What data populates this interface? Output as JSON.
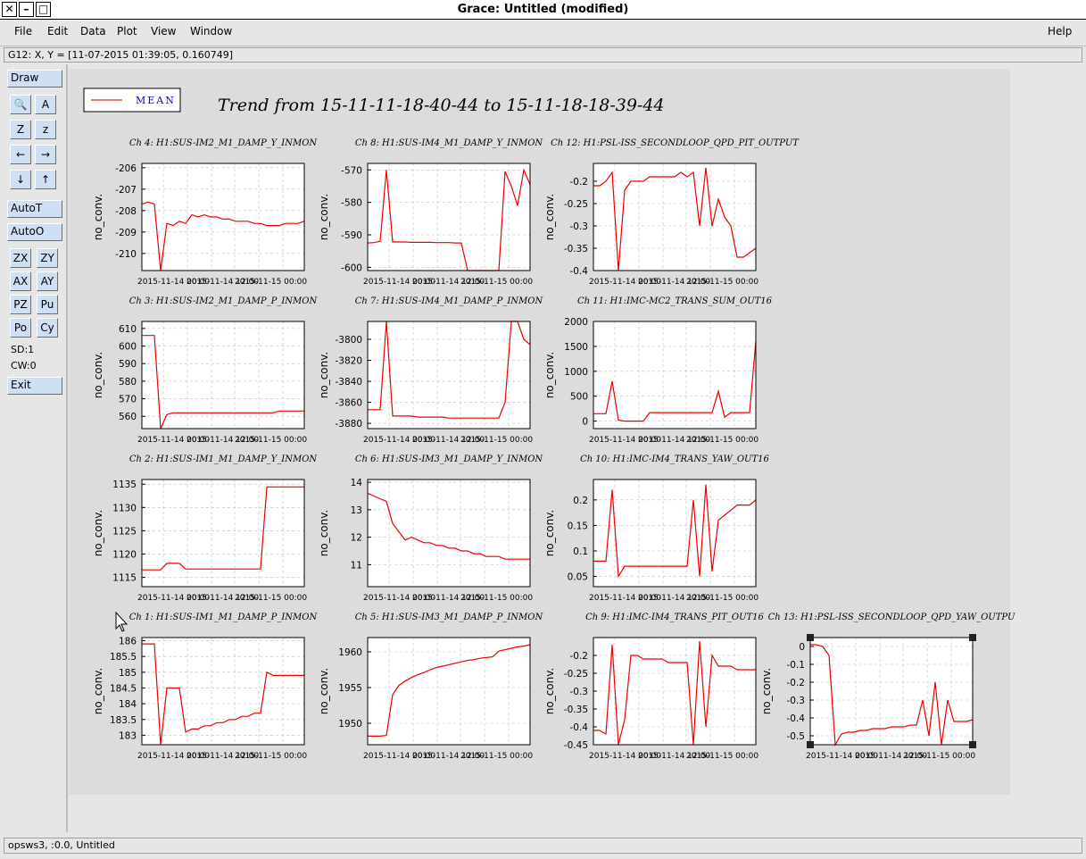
{
  "window": {
    "title": "Grace: Untitled (modified)",
    "close_glyph": "✕",
    "minimize_glyph": "–",
    "maximize_glyph": "□"
  },
  "menu": {
    "items": [
      "File",
      "Edit",
      "Data",
      "Plot",
      "View",
      "Window"
    ],
    "help": "Help"
  },
  "locator": {
    "text": "G12: X, Y = [11-07-2015 01:39:05, 0.160749]"
  },
  "toolbar": {
    "draw": "Draw",
    "zoom_glyph": "🔍",
    "text_glyph": "A",
    "z_glyph": "Z",
    "z_small_glyph": "z",
    "left_glyph": "←",
    "right_glyph": "→",
    "down_glyph": "↓",
    "up_glyph": "↑",
    "autot": "AutoT",
    "autoo": "AutoO",
    "zx": "ZX",
    "zy": "ZY",
    "ax": "AX",
    "ay": "AY",
    "pz": "PZ",
    "pu": "Pu",
    "po": "Po",
    "cy": "Cy",
    "sd": "SD:1",
    "cw": "CW:0",
    "exit": "Exit"
  },
  "status": {
    "text": "opsws3, :0.0, Untitled"
  },
  "legend": {
    "label": "MEAN",
    "color": "#cc0000"
  },
  "colors": {
    "trace": "#ee0000",
    "legend_text": "#0000cc",
    "canvas": "#dcdcdc"
  },
  "page_title": "Trend from 15-11-11-18-40-44 to 15-11-18-18-39-44",
  "x_tick_labels": [
    "2015-11-14 00:00",
    "2015-11-14 12:00",
    "2015-11-15 00:00"
  ],
  "chart_data": [
    {
      "type": "line",
      "title": "Ch 4: H1:SUS-IM2_M1_DAMP_Y_INMON",
      "ylabel": "no_conv.",
      "ylim": [
        -210.8,
        -205.8
      ],
      "yticks": [
        -206,
        -207,
        -208,
        -209,
        -210
      ],
      "values": [
        -207.7,
        -207.6,
        -207.7,
        -210.8,
        -208.6,
        -208.7,
        -208.5,
        -208.6,
        -208.2,
        -208.3,
        -208.2,
        -208.3,
        -208.3,
        -208.4,
        -208.4,
        -208.5,
        -208.5,
        -208.5,
        -208.6,
        -208.6,
        -208.7,
        -208.7,
        -208.7,
        -208.6,
        -208.6,
        -208.6,
        -208.5
      ]
    },
    {
      "type": "line",
      "title": "Ch 8: H1:SUS-IM4_M1_DAMP_Y_INMON",
      "ylabel": "no_conv.",
      "ylim": [
        -601,
        -568
      ],
      "yticks": [
        -570,
        -580,
        -590,
        -600
      ],
      "values": [
        -592.5,
        -592.4,
        -592.0,
        -570.0,
        -592.2,
        -592.2,
        -592.2,
        -592.3,
        -592.3,
        -592.3,
        -592.3,
        -592.4,
        -592.4,
        -592.4,
        -592.5,
        -592.5,
        -601,
        -601,
        -601,
        -601,
        -601,
        -601,
        -570.5,
        -575.0,
        -581.0,
        -570.0,
        -574.5
      ]
    },
    {
      "type": "line",
      "title": "Ch 12: H1:PSL-ISS_SECONDLOOP_QPD_PIT_OUTPUT",
      "ylabel": "no_conv.",
      "ylim": [
        -0.4,
        -0.16
      ],
      "yticks": [
        -0.2,
        -0.25,
        -0.3,
        -0.35,
        -0.4
      ],
      "values": [
        -0.21,
        -0.21,
        -0.2,
        -0.18,
        -0.4,
        -0.22,
        -0.2,
        -0.2,
        -0.2,
        -0.19,
        -0.19,
        -0.19,
        -0.19,
        -0.19,
        -0.18,
        -0.19,
        -0.18,
        -0.3,
        -0.17,
        -0.3,
        -0.24,
        -0.28,
        -0.3,
        -0.37,
        -0.37,
        -0.36,
        -0.35
      ]
    },
    {
      "type": "line",
      "title": "Ch 3: H1:SUS-IM2_M1_DAMP_P_INMON",
      "ylabel": "no_conv.",
      "ylim": [
        553,
        614
      ],
      "yticks": [
        610,
        600,
        590,
        580,
        570,
        560
      ],
      "values": [
        606,
        606,
        606,
        553,
        561,
        562,
        562,
        562,
        562,
        562,
        562,
        562,
        562,
        562,
        562,
        562,
        562,
        562,
        562,
        562,
        562,
        562,
        563,
        563,
        563,
        563,
        563
      ]
    },
    {
      "type": "line",
      "title": "Ch 7: H1:SUS-IM4_M1_DAMP_P_INMON",
      "ylabel": "no_conv.",
      "ylim": [
        -3885,
        -3783
      ],
      "yticks": [
        -3800,
        -3820,
        -3840,
        -3860,
        -3880
      ],
      "values": [
        -3867,
        -3867,
        -3867,
        -3783,
        -3873,
        -3873,
        -3873,
        -3873,
        -3874,
        -3874,
        -3874,
        -3874,
        -3874,
        -3875,
        -3875,
        -3875,
        -3875,
        -3875,
        -3875,
        -3875,
        -3875,
        -3875,
        -3860,
        -3783,
        -3783,
        -3800,
        -3805
      ]
    },
    {
      "type": "line",
      "title": "Ch 11: H1:IMC-MC2_TRANS_SUM_OUT16",
      "ylabel": "no_conv.",
      "ylim": [
        -150,
        2000
      ],
      "yticks": [
        2000,
        1500,
        1000,
        500,
        0
      ],
      "values": [
        150,
        150,
        150,
        800,
        20,
        0,
        0,
        0,
        0,
        170,
        170,
        170,
        170,
        170,
        170,
        170,
        170,
        170,
        170,
        170,
        600,
        80,
        170,
        170,
        170,
        170,
        1600
      ]
    },
    {
      "type": "line",
      "title": "Ch 2: H1:SUS-IM1_M1_DAMP_Y_INMON",
      "ylabel": "no_conv.",
      "ylim": [
        1113,
        1136
      ],
      "yticks": [
        1135,
        1130,
        1125,
        1120,
        1115
      ],
      "values": [
        1116.6,
        1116.6,
        1116.6,
        1116.6,
        1118.0,
        1118.0,
        1118.0,
        1116.8,
        1116.8,
        1116.8,
        1116.8,
        1116.8,
        1116.8,
        1116.8,
        1116.8,
        1116.8,
        1116.8,
        1116.8,
        1116.8,
        1116.8,
        1134.4,
        1134.4,
        1134.4,
        1134.4,
        1134.4,
        1134.4,
        1134.4
      ]
    },
    {
      "type": "line",
      "title": "Ch 6: H1:SUS-IM3_M1_DAMP_Y_INMON",
      "ylabel": "no_conv.",
      "ylim": [
        10.2,
        14.1
      ],
      "yticks": [
        14,
        13,
        12,
        11
      ],
      "values": [
        13.6,
        13.5,
        13.4,
        13.3,
        12.5,
        12.2,
        11.9,
        12.0,
        11.9,
        11.8,
        11.8,
        11.7,
        11.7,
        11.6,
        11.6,
        11.5,
        11.5,
        11.4,
        11.4,
        11.3,
        11.3,
        11.3,
        11.2,
        11.2,
        11.2,
        11.2,
        11.2
      ]
    },
    {
      "type": "line",
      "title": "Ch 10: H1:IMC-IM4_TRANS_YAW_OUT16",
      "ylabel": "no_conv.",
      "ylim": [
        0.03,
        0.24
      ],
      "yticks": [
        0.2,
        0.15,
        0.1,
        0.05
      ],
      "values": [
        0.08,
        0.08,
        0.08,
        0.22,
        0.05,
        0.07,
        0.07,
        0.07,
        0.07,
        0.07,
        0.07,
        0.07,
        0.07,
        0.07,
        0.07,
        0.07,
        0.2,
        0.05,
        0.23,
        0.06,
        0.16,
        0.17,
        0.18,
        0.19,
        0.19,
        0.19,
        0.2
      ]
    },
    {
      "type": "line",
      "title": "Ch 1: H1:SUS-IM1_M1_DAMP_P_INMON",
      "ylabel": "no_conv.",
      "ylim": [
        182.7,
        186.1
      ],
      "yticks": [
        186,
        185.5,
        185,
        184.5,
        184,
        183.5,
        183
      ],
      "values": [
        185.9,
        185.9,
        185.9,
        182.7,
        184.5,
        184.5,
        184.5,
        183.1,
        183.2,
        183.2,
        183.3,
        183.3,
        183.4,
        183.4,
        183.5,
        183.5,
        183.6,
        183.6,
        183.7,
        183.7,
        185.0,
        184.9,
        184.9,
        184.9,
        184.9,
        184.9,
        184.9
      ]
    },
    {
      "type": "line",
      "title": "Ch 5: H1:SUS-IM3_M1_DAMP_P_INMON",
      "ylabel": "no_conv.",
      "ylim": [
        1947,
        1962
      ],
      "yticks": [
        1960,
        1955,
        1950
      ],
      "values": [
        1948.2,
        1948.2,
        1948.2,
        1948.3,
        1954.0,
        1955.3,
        1955.9,
        1956.4,
        1956.8,
        1957.1,
        1957.5,
        1957.8,
        1958.0,
        1958.2,
        1958.4,
        1958.6,
        1958.8,
        1958.9,
        1959.1,
        1959.2,
        1959.3,
        1960.1,
        1960.3,
        1960.5,
        1960.7,
        1960.8,
        1961.0
      ]
    },
    {
      "type": "line",
      "title": "Ch 9: H1:IMC-IM4_TRANS_PIT_OUT16",
      "ylabel": "no_conv.",
      "ylim": [
        -0.45,
        -0.15
      ],
      "yticks": [
        -0.2,
        -0.25,
        -0.3,
        -0.35,
        -0.4,
        -0.45
      ],
      "values": [
        -0.41,
        -0.41,
        -0.42,
        -0.17,
        -0.45,
        -0.38,
        -0.2,
        -0.2,
        -0.21,
        -0.21,
        -0.21,
        -0.21,
        -0.22,
        -0.22,
        -0.22,
        -0.22,
        -0.45,
        -0.16,
        -0.4,
        -0.2,
        -0.23,
        -0.23,
        -0.23,
        -0.24,
        -0.24,
        -0.24,
        -0.24
      ]
    },
    {
      "type": "line",
      "title": "Ch 13: H1:PSL-ISS_SECONDLOOP_QPD_YAW_OUTPU",
      "ylabel": "no_conv.",
      "ylim": [
        -0.55,
        0.05
      ],
      "yticks": [
        0,
        -0.1,
        -0.2,
        -0.3,
        -0.4,
        -0.5
      ],
      "values": [
        0.01,
        0.01,
        0.0,
        -0.05,
        -0.55,
        -0.49,
        -0.48,
        -0.48,
        -0.47,
        -0.47,
        -0.46,
        -0.46,
        -0.46,
        -0.45,
        -0.45,
        -0.45,
        -0.44,
        -0.44,
        -0.3,
        -0.5,
        -0.2,
        -0.55,
        -0.3,
        -0.42,
        -0.42,
        -0.42,
        -0.41
      ]
    }
  ]
}
